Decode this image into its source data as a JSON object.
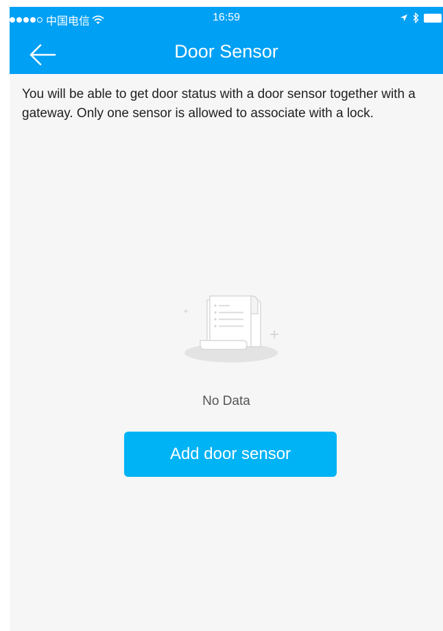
{
  "status_bar": {
    "carrier": "中国电信",
    "time": "16:59",
    "signal_icon": "signal-dots-icon",
    "wifi_icon": "wifi-icon",
    "location_icon": "location-arrow-icon",
    "bluetooth_icon": "bluetooth-icon",
    "battery_icon": "battery-icon"
  },
  "navbar": {
    "title": "Door Sensor",
    "back_icon": "back-arrow-icon",
    "background_color": "#00a0f4"
  },
  "main": {
    "description": "You will be able to get door status with a door sensor together with a gateway. Only one sensor is allowed to associate with a lock.",
    "empty_state": {
      "icon": "empty-document-icon",
      "text": "No Data"
    },
    "add_button": {
      "label": "Add door sensor",
      "color": "#00b3f5"
    }
  }
}
